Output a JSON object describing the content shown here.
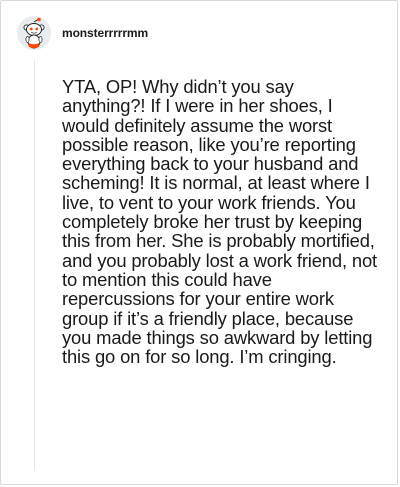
{
  "comment": {
    "username": "monsterrrrrmm",
    "avatar_icon": "reddit-snoo-avatar-icon",
    "body": "YTA, OP! Why didn’t you say anything?! If I were in her shoes, I would definitely assume the worst possible reason, like you’re reporting everything back to your husband and scheming! It is normal, at least where I live, to vent to your work friends. You completely broke her trust by keeping this from her. She is probably mortified, and you probably lost a work friend, not to mention this could have repercussions for your entire work group if it’s a friendly place, because you made things so awkward by letting this go on for so long. I’m cringing."
  },
  "colors": {
    "text": "#1a1a1b",
    "border": "#d9d9d9",
    "thread_line": "#e6e6e6",
    "avatar_accent": "#ff4500"
  }
}
